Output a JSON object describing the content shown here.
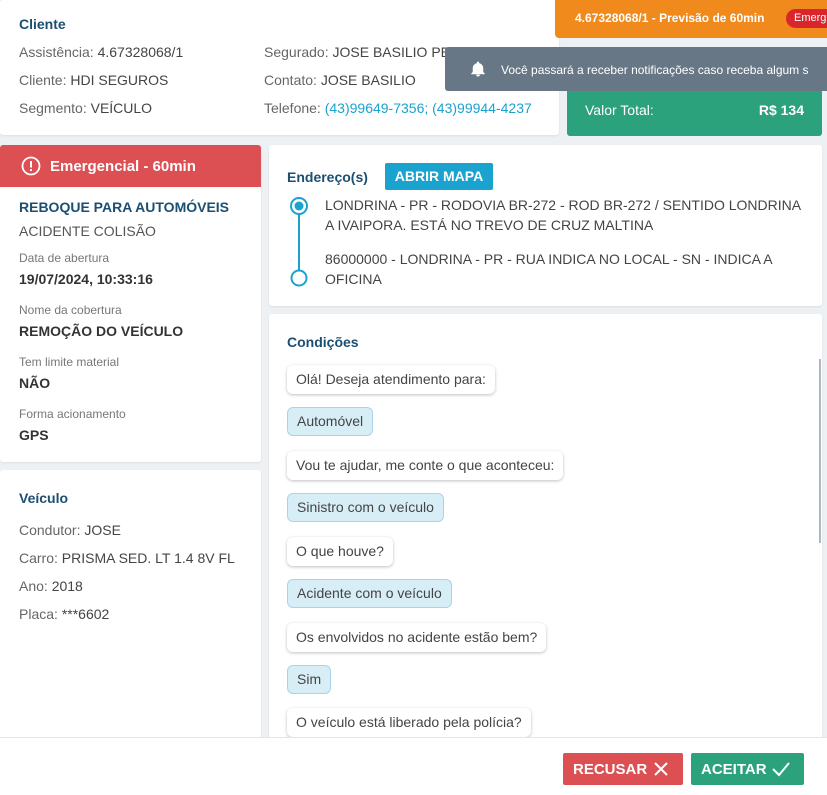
{
  "client": {
    "title": "Cliente",
    "assistencia_label": "Assistência:",
    "assistencia": "4.67328068/1",
    "cliente_label": "Cliente:",
    "cliente": "HDI SEGUROS",
    "segmento_label": "Segmento:",
    "segmento": "VEÍCULO",
    "segurado_label": "Segurado:",
    "segurado": "JOSE BASILIO PE",
    "contato_label": "Contato:",
    "contato": "JOSE BASILIO",
    "telefone_label": "Telefone:",
    "telefone": "(43)99649-7356; (43)99944-4237"
  },
  "banner": {
    "text": "4.67328068/1 - Previsão de 60min",
    "badge": "Emerg",
    "color": "#f08a1c"
  },
  "notification": {
    "icon": "bell-icon",
    "text": "Você passará a receber notificações caso receba algum s"
  },
  "total": {
    "label": "Valor Total:",
    "value": "R$ 134",
    "color": "#2ba27b"
  },
  "service": {
    "header": "Emergencial - 60min",
    "header_icon": "info-circle-icon",
    "header_color": "#dc4f52",
    "type": "REBOQUE PARA AUTOMÓVEIS",
    "subtype": "ACIDENTE COLISÃO",
    "fields": [
      {
        "label": "Data de abertura",
        "value": "19/07/2024, 10:33:16"
      },
      {
        "label": "Nome da cobertura",
        "value": "REMOÇÃO DO VEÍCULO"
      },
      {
        "label": "Tem limite material",
        "value": "NÃO"
      },
      {
        "label": "Forma acionamento",
        "value": "GPS"
      }
    ]
  },
  "vehicle": {
    "title": "Veículo",
    "condutor_label": "Condutor:",
    "condutor": "JOSE",
    "carro_label": "Carro:",
    "carro": "PRISMA SED. LT 1.4 8V FL",
    "ano_label": "Ano:",
    "ano": "2018",
    "placa_label": "Placa:",
    "placa": "***6602"
  },
  "address": {
    "title": "Endereço(s)",
    "map_button": "ABRIR MAPA",
    "origin": "LONDRINA - PR - RODOVIA BR-272 - ROD BR-272 / SENTIDO LONDRINA A IVAIPORA. ESTÁ NO TREVO DE CRUZ MALTINA",
    "destination": "86000000 - LONDRINA - PR - RUA INDICA NO LOCAL - SN - INDICA A OFICINA"
  },
  "conditions": {
    "title": "Condições",
    "messages": [
      {
        "text": "Olá! Deseja atendimento para:",
        "answer": false
      },
      {
        "text": "Automóvel",
        "answer": true
      },
      {
        "text": "Vou te ajudar, me conte o que aconteceu:",
        "answer": false
      },
      {
        "text": "Sinistro com o veículo",
        "answer": true
      },
      {
        "text": "O que houve?",
        "answer": false
      },
      {
        "text": "Acidente com o veículo",
        "answer": true
      },
      {
        "text": "Os envolvidos no acidente estão bem?",
        "answer": false
      },
      {
        "text": "Sim",
        "answer": true
      },
      {
        "text": "O veículo está liberado pela polícia?",
        "answer": false
      }
    ]
  },
  "footer": {
    "reject_label": "RECUSAR",
    "reject_color": "#dc4f52",
    "accept_label": "ACEITAR",
    "accept_color": "#2ba27b"
  }
}
